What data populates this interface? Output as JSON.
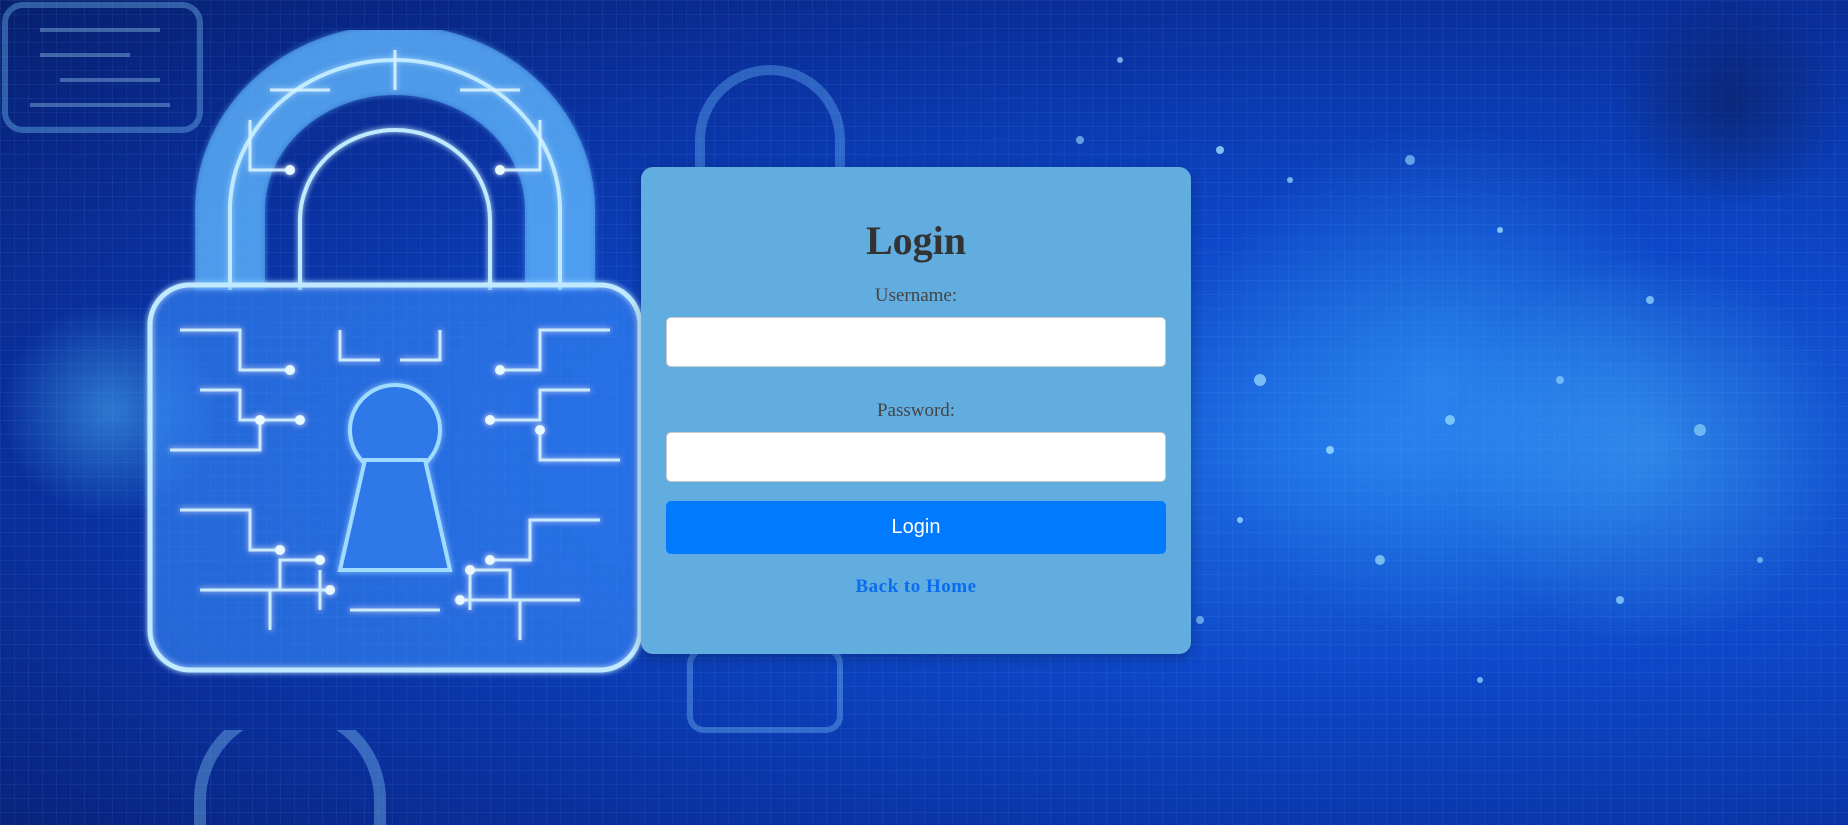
{
  "background": {
    "image": "digital-padlock-circuit-background",
    "accent_color": "#0d47c9"
  },
  "login": {
    "title": "Login",
    "username_label": "Username:",
    "username_value": "",
    "username_placeholder": "",
    "password_label": "Password:",
    "password_value": "",
    "password_placeholder": "",
    "submit_label": "Login",
    "back_link_label": "Back to Home",
    "card_color": "#62ade0",
    "button_color": "#007bff"
  }
}
